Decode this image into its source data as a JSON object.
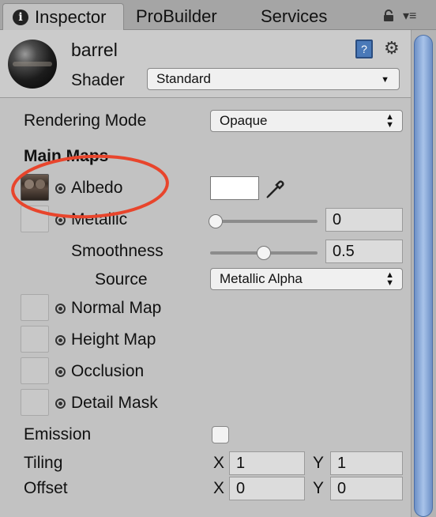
{
  "tabs": [
    {
      "label": "Inspector",
      "icon": "info-icon",
      "active": true
    },
    {
      "label": "ProBuilder",
      "active": false
    },
    {
      "label": "Services",
      "active": false
    }
  ],
  "header": {
    "object_name": "barrel",
    "shader_label": "Shader",
    "shader_value": "Standard",
    "help_icon": "?"
  },
  "rendering_mode": {
    "label": "Rendering Mode",
    "value": "Opaque"
  },
  "main_maps": {
    "title": "Main Maps",
    "albedo": {
      "label": "Albedo",
      "color": "#ffffff"
    },
    "metallic": {
      "label": "Metallic",
      "value": "0",
      "level": 0
    },
    "smoothness": {
      "label": "Smoothness",
      "value": "0.5",
      "level": 0.5
    },
    "source": {
      "label": "Source",
      "value": "Metallic Alpha"
    },
    "normal_map": {
      "label": "Normal Map"
    },
    "height_map": {
      "label": "Height Map"
    },
    "occlusion": {
      "label": "Occlusion"
    },
    "detail_mask": {
      "label": "Detail Mask"
    }
  },
  "emission": {
    "label": "Emission",
    "checked": false
  },
  "tiling": {
    "label": "Tiling",
    "x_label": "X",
    "x": "1",
    "y_label": "Y",
    "y": "1"
  },
  "offset": {
    "label": "Offset",
    "x_label": "X",
    "x": "0",
    "y_label": "Y",
    "y": "0"
  },
  "colors": {
    "annotation": "#e8452c",
    "scroll_thumb": "#8aaee0"
  }
}
